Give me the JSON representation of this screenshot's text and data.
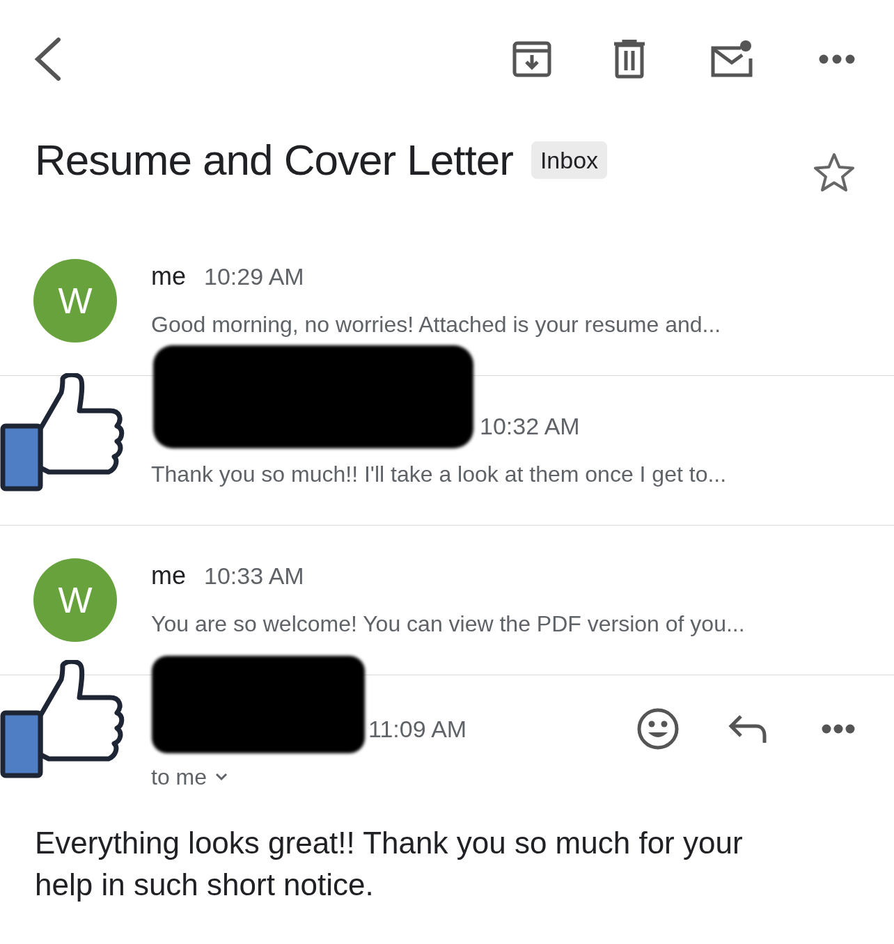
{
  "subject": "Resume and Cover Letter",
  "label": "Inbox",
  "starred": false,
  "messages": [
    {
      "kind": "collapsed",
      "sender": "me",
      "time": "10:29 AM",
      "snippet": "Good morning, no worries! Attached is your resume and...",
      "avatar": "W",
      "color": "#67a23c",
      "redacted": false
    },
    {
      "kind": "collapsed",
      "time": "10:32 AM",
      "snippet": "Thank you so much!! I'll take a look at them once I get to...",
      "redacted": true
    },
    {
      "kind": "collapsed",
      "sender": "me",
      "time": "10:33 AM",
      "snippet": "You are so welcome! You can view the PDF version of you...",
      "avatar": "W",
      "color": "#67a23c",
      "redacted": false
    },
    {
      "kind": "expanded",
      "time": "11:09 AM",
      "recipient": "to me",
      "body": "Everything looks great!! Thank you so much for your help in such short notice.",
      "redacted": true
    }
  ]
}
